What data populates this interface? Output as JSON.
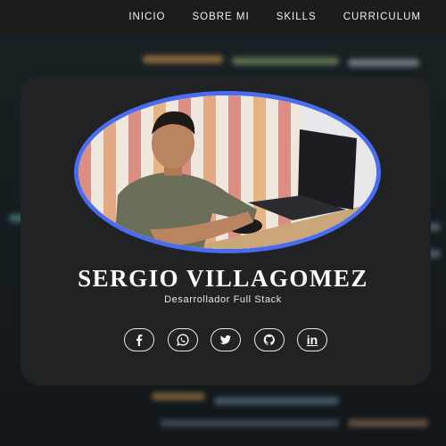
{
  "nav": {
    "items": [
      "INICIO",
      "SOBRE MI",
      "SKILLS",
      "CURRICULUM"
    ]
  },
  "profile": {
    "name": "SERGIO VILLAGOMEZ",
    "role": "Desarrollador Full Stack"
  },
  "social": [
    {
      "icon": "facebook-icon"
    },
    {
      "icon": "whatsapp-icon"
    },
    {
      "icon": "twitter-icon"
    },
    {
      "icon": "github-icon"
    },
    {
      "icon": "linkedin-icon",
      "label": "in"
    }
  ],
  "colors": {
    "accent": "#4a6cf0",
    "card": "#202224",
    "nav": "#1c1c1c"
  }
}
